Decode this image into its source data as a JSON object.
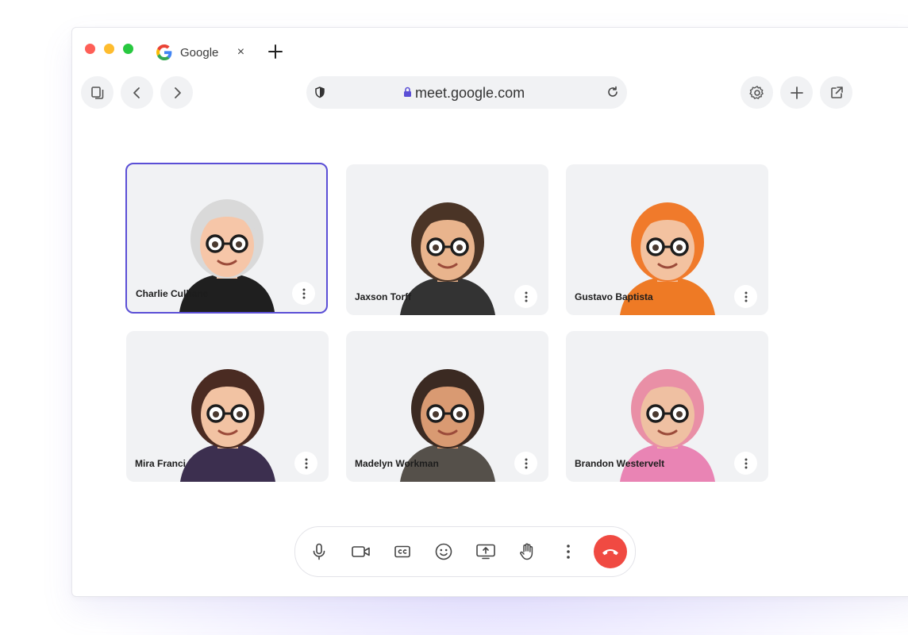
{
  "browser": {
    "tab_title": "Google",
    "tab_close": "×",
    "address_url": "meet.google.com"
  },
  "toolbar": {
    "left_icons": [
      "tabs-icon",
      "back-icon",
      "forward-icon"
    ],
    "right_icons": [
      "settings-icon",
      "plus-icon",
      "share-icon"
    ]
  },
  "participants": [
    {
      "name": "Charlie Culhane",
      "active": true,
      "hair": "#d9d9d9",
      "skin": "#f6c6a8",
      "top": "#1f1f1f"
    },
    {
      "name": "Jaxson Torff",
      "active": false,
      "hair": "#4a3426",
      "skin": "#e9b48d",
      "top": "#333333"
    },
    {
      "name": "Gustavo Baptista",
      "active": false,
      "hair": "#f07a2b",
      "skin": "#f3c2a0",
      "top": "#ee7a25"
    },
    {
      "name": "Mira Franci",
      "active": false,
      "hair": "#4a2b22",
      "skin": "#f2c3a3",
      "top": "#3c2f4f"
    },
    {
      "name": "Madelyn Workman",
      "active": false,
      "hair": "#3b2a22",
      "skin": "#d99a72",
      "top": "#55504a"
    },
    {
      "name": "Brandon Westervelt",
      "active": false,
      "hair": "#e98fa6",
      "skin": "#efc0a2",
      "top": "#e984b4"
    }
  ],
  "controls": [
    "mic-icon",
    "camera-icon",
    "captions-icon",
    "emoji-icon",
    "present-icon",
    "raise-hand-icon",
    "more-options-icon",
    "end-call-icon"
  ],
  "colors": {
    "accent": "#5b4fd6",
    "end_call": "#f04a42",
    "tile_bg": "#f1f2f4"
  }
}
